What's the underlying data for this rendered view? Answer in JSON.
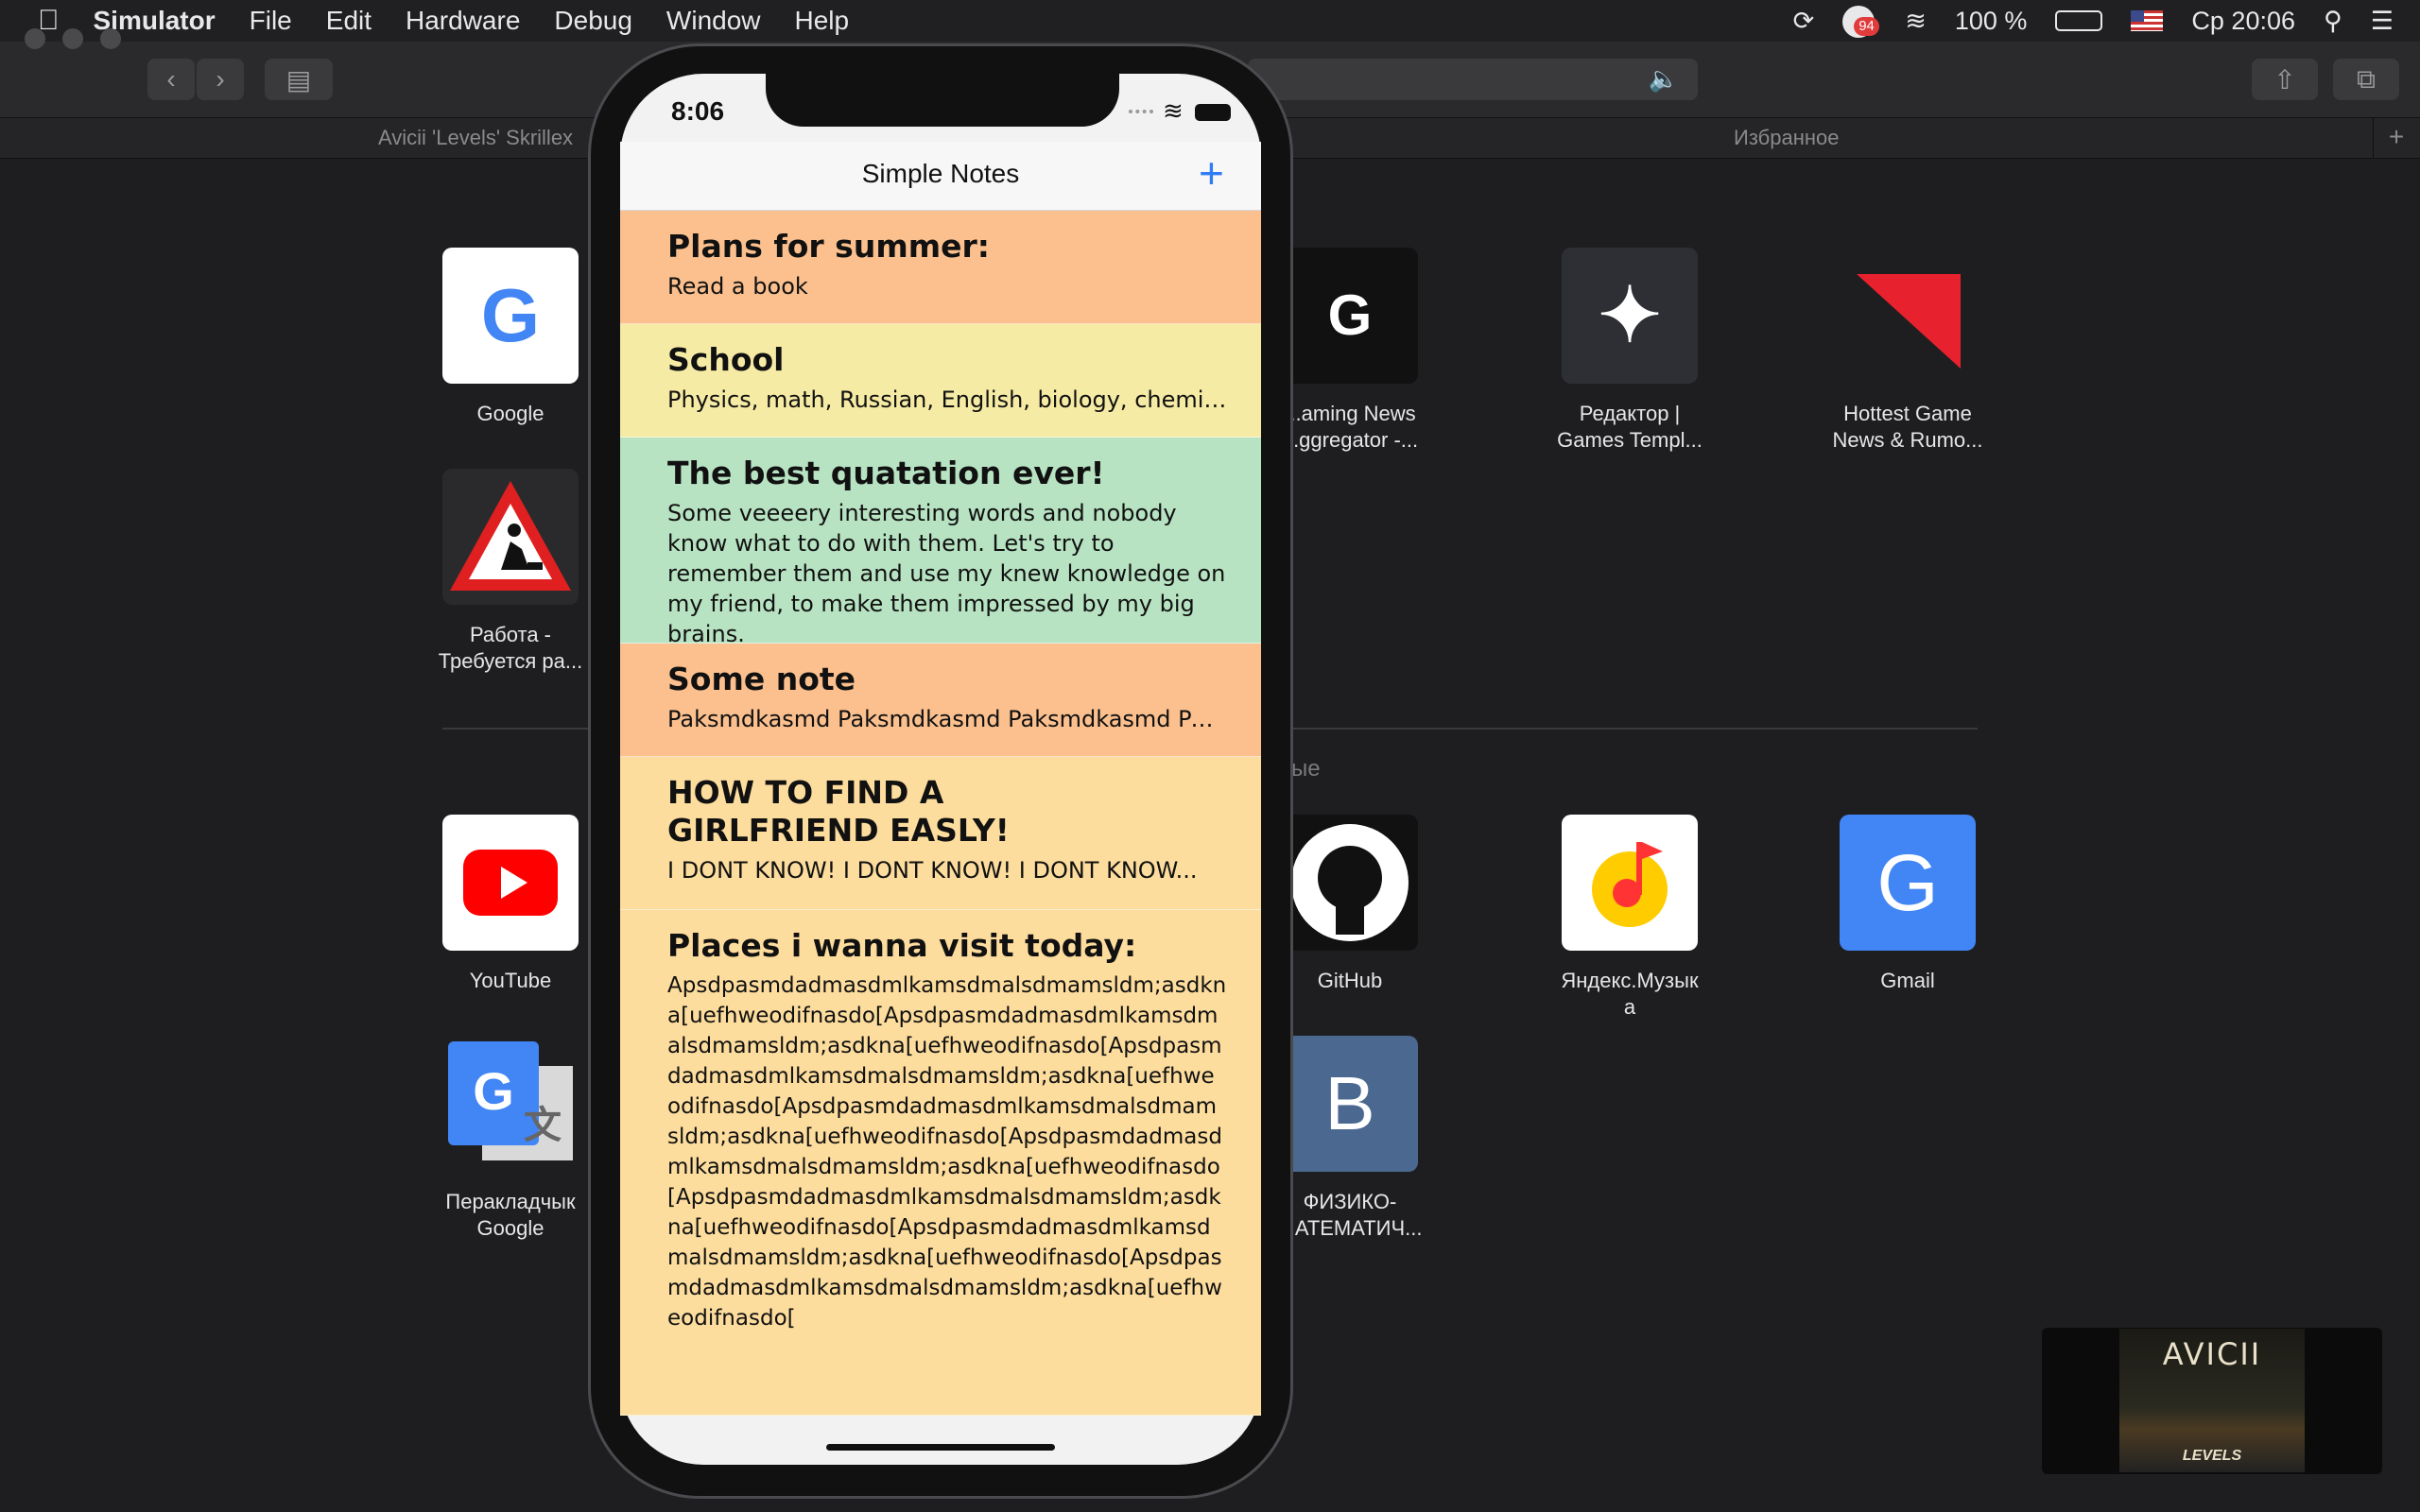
{
  "menubar": {
    "apple_icon": "apple-icon",
    "app_name": "Simulator",
    "items": [
      "File",
      "Edit",
      "Hardware",
      "Debug",
      "Window",
      "Help"
    ],
    "notification_badge": "94",
    "battery": "100 %",
    "clock": "Ср 20:06"
  },
  "safari": {
    "tabs": [
      "Avicii 'Levels' Skrillex",
      "Избранное"
    ],
    "favorites": [
      {
        "label": "Google",
        "icon": "google-icon"
      },
      {
        "label": "Работа -\nТребуется ра...",
        "icon": "roadwork-icon"
      },
      {
        "label": "...aming News\n...ggregator -...",
        "icon": "gna-icon"
      },
      {
        "label": "Редактор |\nGames Templ...",
        "icon": "star-icon"
      },
      {
        "label": "Hottest Game\nNews & Rumo...",
        "icon": "red-triangle-icon"
      }
    ],
    "section_label": "ые",
    "frequent": [
      {
        "label": "YouTube",
        "icon": "youtube-icon"
      },
      {
        "label": "GitHub",
        "icon": "github-icon"
      },
      {
        "label": "Яндекс.Музык\nа",
        "icon": "yandex-music-icon"
      },
      {
        "label": "Gmail",
        "icon": "gmail-icon",
        "glyph": "G"
      },
      {
        "label": "Перакладчык\nGoogle",
        "icon": "google-translate-icon"
      },
      {
        "label": "ФИЗИКО-\n...АТЕМАТИЧ...",
        "icon": "vk-icon",
        "glyph": "B"
      }
    ],
    "video_title": "AVICII",
    "video_subtitle": "LEVELS"
  },
  "phone": {
    "status_time": "8:06",
    "nav_title": "Simple Notes",
    "add_icon": "plus-icon",
    "notes": [
      {
        "title": "Plans for summer:",
        "body": "Read a book",
        "color": "#fbc08e"
      },
      {
        "title": "School",
        "body": "Physics, math, Russian, English, biology, chemistry,...",
        "color": "#f6eba4"
      },
      {
        "title": "The best quatation ever!",
        "body": "Some veeeery interesting words and nobody know what to do with them. Let's try to remember them and use my knew knowledge on my friend, to make them impressed by my big brains.",
        "color": "#b7e3c2"
      },
      {
        "title": "Some note",
        "body": "Paksmdkasmd Paksmdkasmd Paksmdkasmd Paksmd...",
        "color": "#fbc08e"
      },
      {
        "title": "HOW TO FIND A GIRLFRIEND EASLY!",
        "body": "I DONT KNOW! I DONT KNOW! I DONT KNOW...",
        "color": "#fddd9d"
      },
      {
        "title": "Places i wanna visit today:",
        "body": "Apsdpasmdadmasdmlkamsdmalsdmamsldm;asdkna[uefhweodifnasdo[Apsdpasmdadmasdmlkamsdmalsdmamsldm;asdkna[uefhweodifnasdo[Apsdpasmdadmasdmlkamsdmalsdmamsldm;asdkna[uefhweodifnasdo[Apsdpasmdadmasdmlkamsdmalsdmamsldm;asdkna[uefhweodifnasdo[Apsdpasmdadmasdmlkamsdmalsdmamsldm;asdkna[uefhweodifnasdo[Apsdpasmdadmasdmlkamsdmalsdmamsldm;asdkna[uefhweodifnasdo[Apsdpasmdadmasdmlkamsdmalsdmamsldm;asdkna[uefhweodifnasdo[Apsdpasmdadmasdmlkamsdmalsdmamsldm;asdkna[uefhweodifnasdo[",
        "color": "#fddd9d"
      }
    ]
  }
}
